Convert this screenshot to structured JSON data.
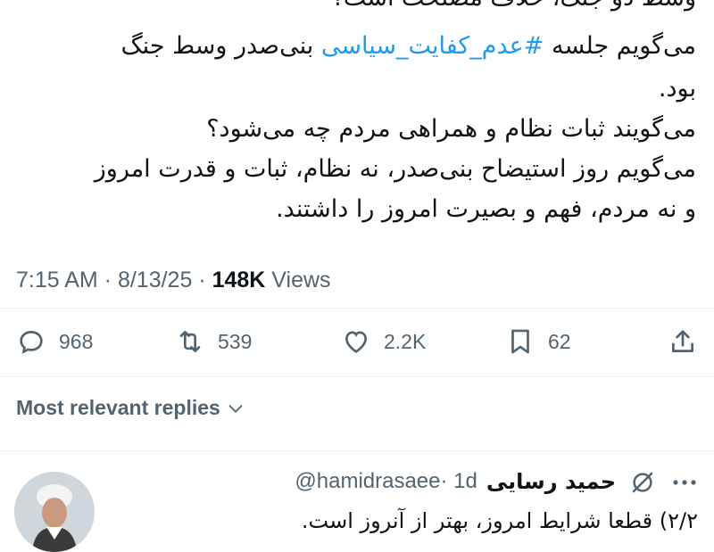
{
  "tweet": {
    "lines": [
      "وسط دو جنگ، خلاف مصلحت است؟",
      "بنی‌صدر وسط جنگ",
      "بود.",
      "می‌گویند ثبات نظام و همراهی مردم چه می‌شود؟",
      "می‌گویم روز استیضاح بنی‌صدر، نه نظام، ثبات و قدرت امروز",
      "و نه مردم، فهم و بصیرت امروز را داشتند."
    ],
    "line2_prefix": "می‌گویم جلسه",
    "hashtag": "#عدم_کفایت_سیاسی",
    "time": "7:15 AM",
    "sep1": " · ",
    "date": "8/13/25",
    "sep2": " · ",
    "views_count": "148K",
    "views_label": " Views"
  },
  "actions": {
    "replies": "968",
    "retweets": "539",
    "likes": "2.2K",
    "bookmarks": "62"
  },
  "replies_sort_label": "Most relevant replies",
  "reply": {
    "name": "حمید رسایی",
    "handle": "@hamidrasaee",
    "time": " · 1d",
    "text": "۲/۲) قطعا شرایط امروز، بهتر از آنروز است."
  },
  "colors": {
    "text": "#0f1419",
    "muted": "#536471",
    "link": "#1d9bf0",
    "divider": "#eff3f4"
  }
}
